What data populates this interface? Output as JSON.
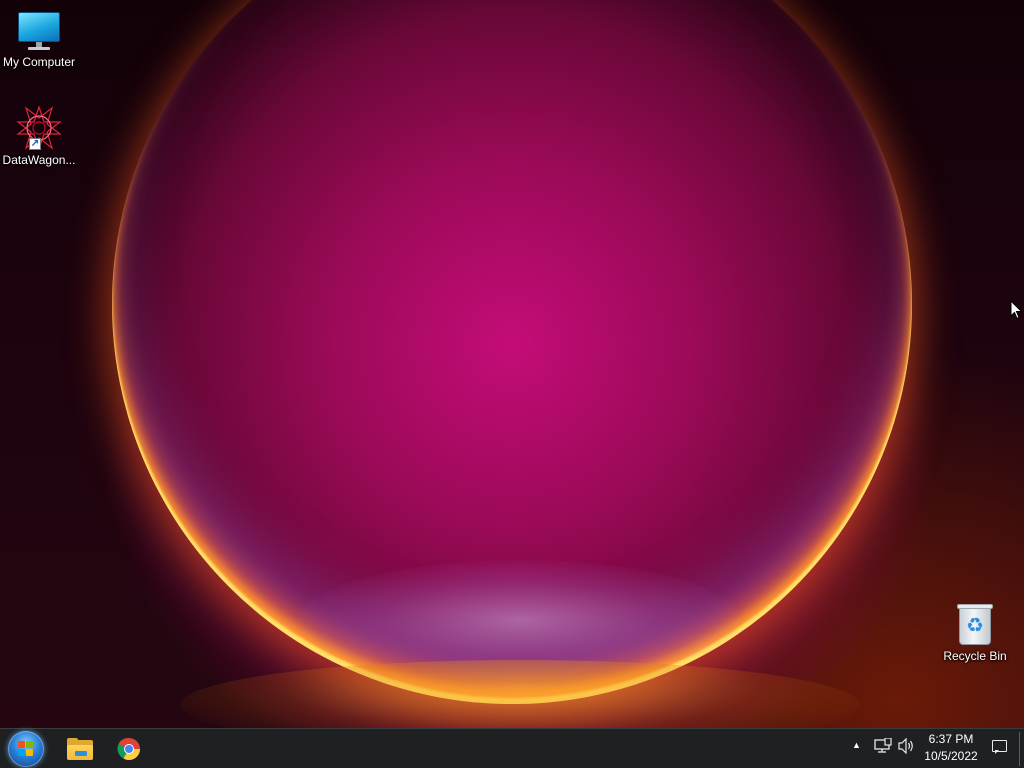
{
  "desktop": {
    "icons": [
      {
        "label": "My Computer",
        "icon": "monitor-icon"
      },
      {
        "label": "DataWagon...",
        "icon": "star-logo-icon"
      },
      {
        "label": "Recycle Bin",
        "icon": "recycle-bin-icon"
      }
    ]
  },
  "taskbar": {
    "start_icon": "windows-logo-icon",
    "pinned": [
      {
        "name": "File Explorer",
        "icon": "folder-icon"
      },
      {
        "name": "Google Chrome",
        "icon": "chrome-icon"
      }
    ],
    "tray": {
      "overflow_icon": "chevron-up-icon",
      "network_icon": "network-icon",
      "volume_icon": "volume-icon",
      "time": "6:37 PM",
      "date": "10/5/2022",
      "notification_icon": "notification-icon"
    }
  },
  "colors": {
    "taskbar": "#1e2022",
    "accent": "#c40c78"
  }
}
